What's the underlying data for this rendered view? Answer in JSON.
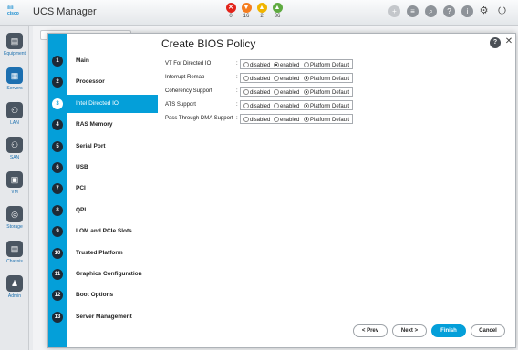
{
  "header": {
    "logo_text": "cisco",
    "title": "UCS Manager",
    "faults": [
      {
        "icon": "critical-fault-icon",
        "glyph": "✕",
        "color": "#e2231a",
        "count": "0"
      },
      {
        "icon": "major-fault-icon",
        "glyph": "▼",
        "color": "#f57d1f",
        "count": "16"
      },
      {
        "icon": "minor-fault-icon",
        "glyph": "▲",
        "color": "#f0b400",
        "count": "2"
      },
      {
        "icon": "warning-fault-icon",
        "glyph": "▲",
        "color": "#5eaa40",
        "count": "36"
      }
    ],
    "toolbar_icons": [
      "add-icon",
      "list-icon",
      "search-icon",
      "help-icon",
      "info-icon",
      "gear-icon",
      "power-icon"
    ]
  },
  "leftnav": [
    {
      "label": "Equipment",
      "glyph": "▤",
      "active": false
    },
    {
      "label": "Servers",
      "glyph": "▦",
      "active": true
    },
    {
      "label": "LAN",
      "glyph": "⚇",
      "active": false
    },
    {
      "label": "SAN",
      "glyph": "⚇",
      "active": false
    },
    {
      "label": "VM",
      "glyph": "▣",
      "active": false
    },
    {
      "label": "Storage",
      "glyph": "◎",
      "active": false
    },
    {
      "label": "Chassis",
      "glyph": "▤",
      "active": false
    },
    {
      "label": "Admin",
      "glyph": "♟",
      "active": false
    }
  ],
  "dialog": {
    "title": "Create BIOS Policy",
    "help": "?",
    "close": "✕",
    "steps": [
      {
        "num": "1",
        "label": "Main"
      },
      {
        "num": "2",
        "label": "Processor"
      },
      {
        "num": "3",
        "label": "Intel Directed IO"
      },
      {
        "num": "4",
        "label": "RAS Memory"
      },
      {
        "num": "5",
        "label": "Serial Port"
      },
      {
        "num": "6",
        "label": "USB"
      },
      {
        "num": "7",
        "label": "PCI"
      },
      {
        "num": "8",
        "label": "QPI"
      },
      {
        "num": "9",
        "label": "LOM and PCIe Slots"
      },
      {
        "num": "10",
        "label": "Trusted Platform"
      },
      {
        "num": "11",
        "label": "Graphics Configuration"
      },
      {
        "num": "12",
        "label": "Boot Options"
      },
      {
        "num": "13",
        "label": "Server Management"
      }
    ],
    "active_step": "3",
    "options": [
      "disabled",
      "enabled",
      "Platform Default"
    ],
    "settings": [
      {
        "name": "VT For Directed IO",
        "selected": "enabled"
      },
      {
        "name": "Interrupt Remap",
        "selected": "Platform Default"
      },
      {
        "name": "Coherency Support",
        "selected": "Platform Default"
      },
      {
        "name": "ATS Support",
        "selected": "Platform Default"
      },
      {
        "name": "Pass Through DMA Support",
        "selected": "Platform Default"
      }
    ],
    "buttons": {
      "prev": "< Prev",
      "next": "Next >",
      "finish": "Finish",
      "cancel": "Cancel"
    }
  }
}
